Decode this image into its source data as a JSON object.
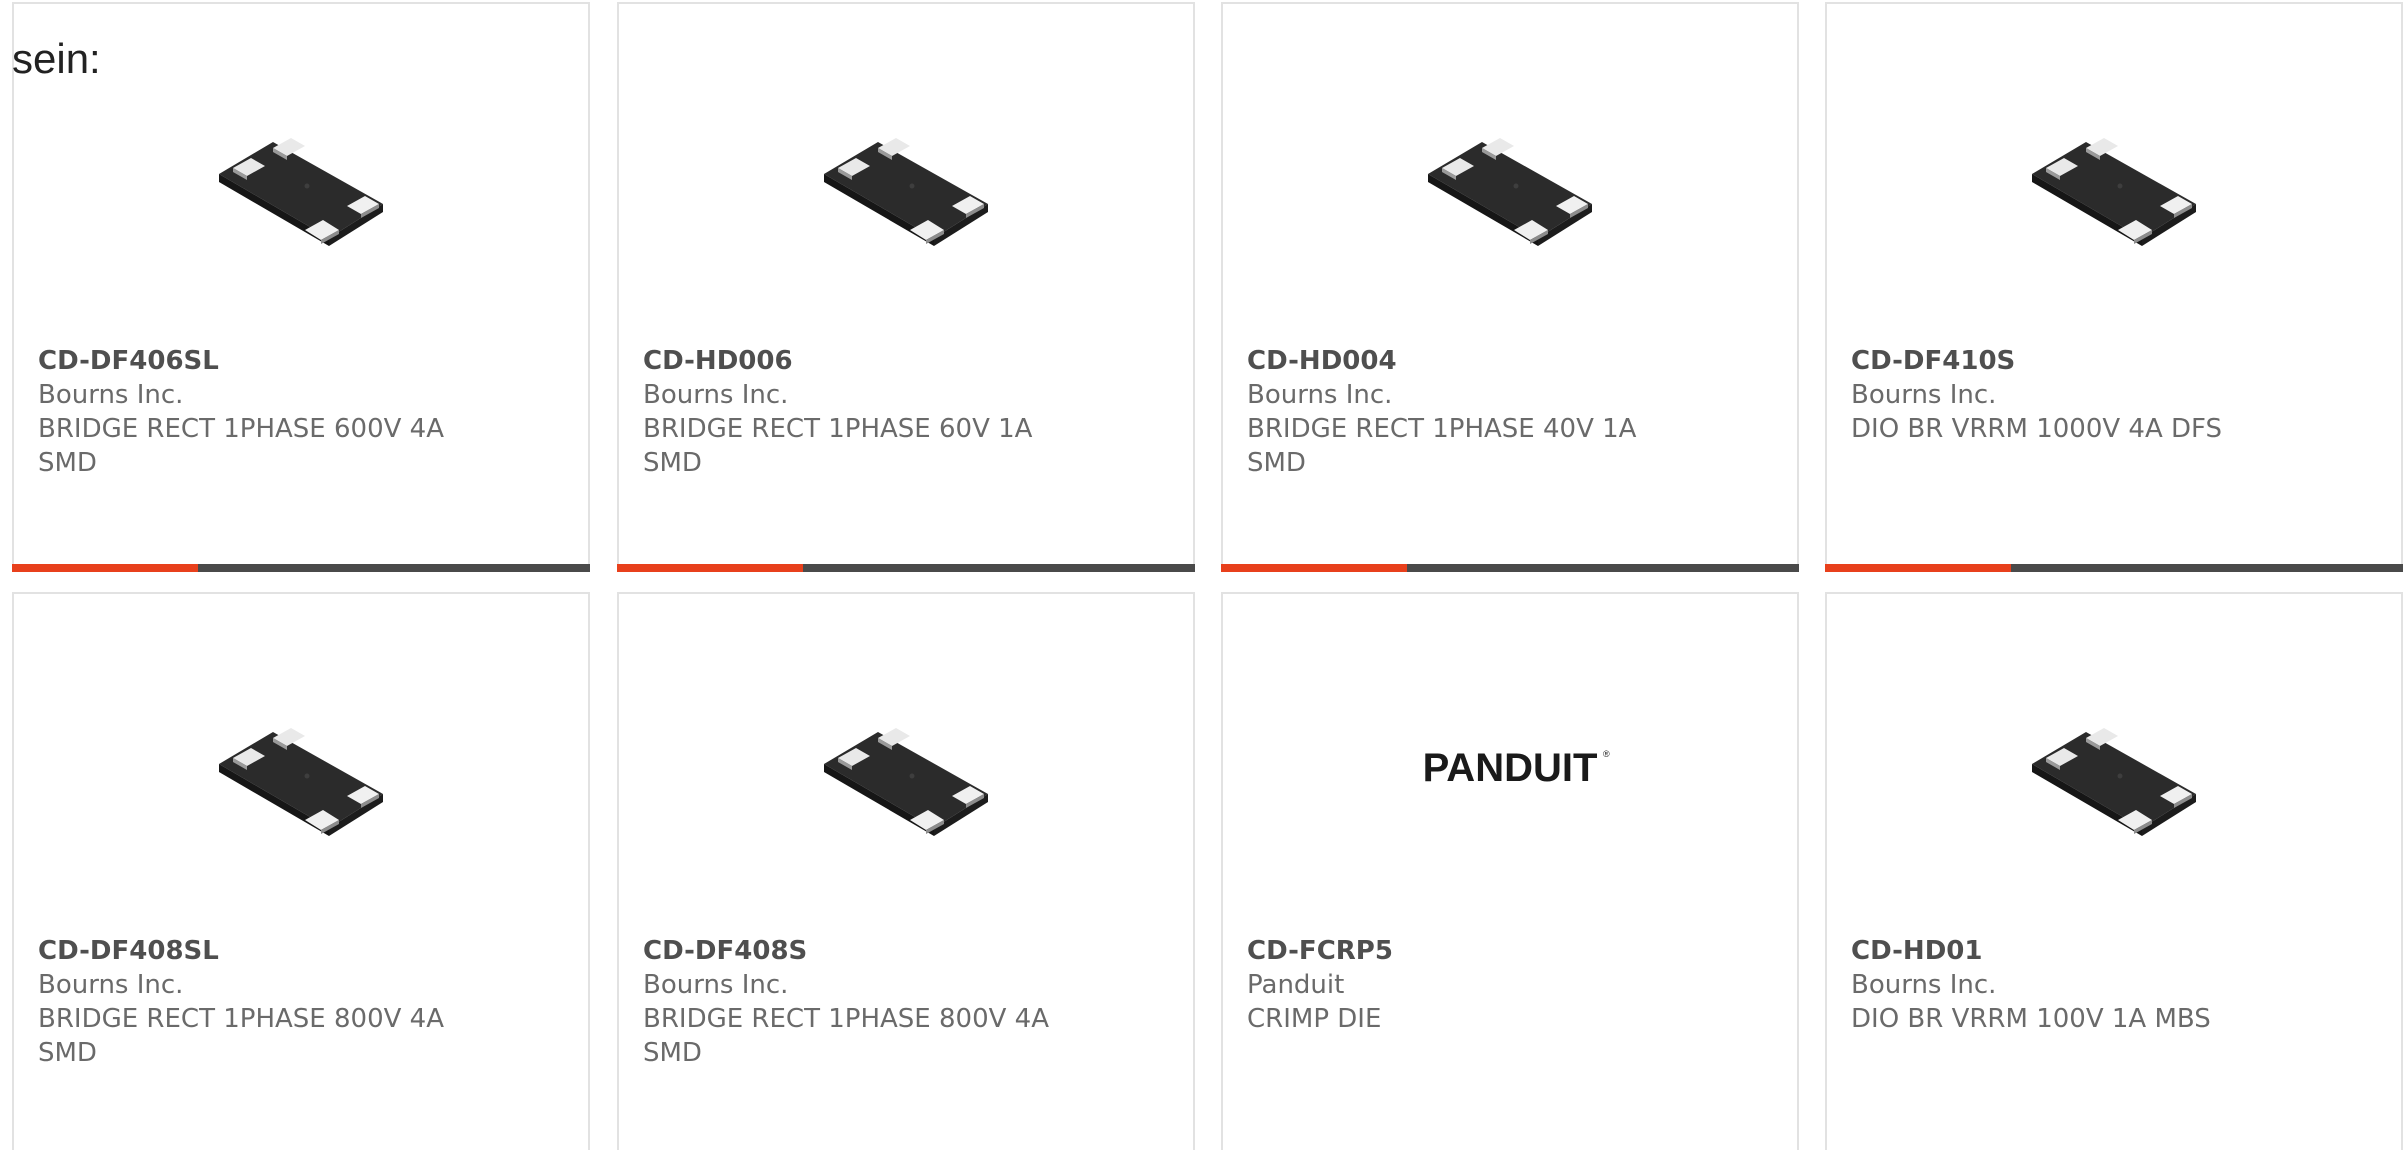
{
  "intro_text": "sein:",
  "colors": {
    "accent": "#e8401c",
    "bar": "#4a4a4a",
    "border": "#e2e2e2"
  },
  "products": [
    {
      "part_number": "CD-DF406SL",
      "manufacturer": "Bourns Inc.",
      "description": "BRIDGE RECT 1PHASE 600V 4A SMD",
      "image": "bridge-rectifier-chip-icon"
    },
    {
      "part_number": "CD-HD006",
      "manufacturer": "Bourns Inc.",
      "description": "BRIDGE RECT 1PHASE 60V 1A SMD",
      "image": "bridge-rectifier-chip-icon"
    },
    {
      "part_number": "CD-HD004",
      "manufacturer": "Bourns Inc.",
      "description": "BRIDGE RECT 1PHASE 40V 1A SMD",
      "image": "bridge-rectifier-chip-icon"
    },
    {
      "part_number": "CD-DF410S",
      "manufacturer": "Bourns Inc.",
      "description": "DIO BR VRRM 1000V 4A DFS",
      "image": "bridge-rectifier-chip-icon"
    },
    {
      "part_number": "CD-DF408SL",
      "manufacturer": "Bourns Inc.",
      "description": "BRIDGE RECT 1PHASE 800V 4A SMD",
      "image": "bridge-rectifier-chip-icon"
    },
    {
      "part_number": "CD-DF408S",
      "manufacturer": "Bourns Inc.",
      "description": "BRIDGE RECT 1PHASE 800V 4A SMD",
      "image": "bridge-rectifier-chip-icon"
    },
    {
      "part_number": "CD-FCRP5",
      "manufacturer": "Panduit",
      "description": "CRIMP DIE",
      "image": "panduit-logo",
      "logo_text": "PANDUIT"
    },
    {
      "part_number": "CD-HD01",
      "manufacturer": "Bourns Inc.",
      "description": "DIO BR VRRM 100V 1A MBS",
      "image": "bridge-rectifier-chip-icon"
    }
  ]
}
